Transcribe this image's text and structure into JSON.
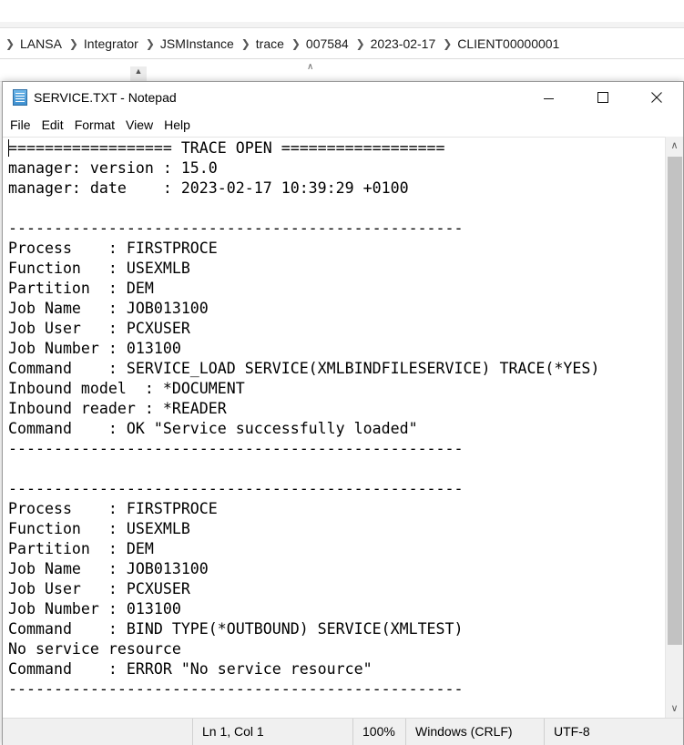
{
  "explorer": {
    "breadcrumb": [
      "LANSA",
      "Integrator",
      "JSMInstance",
      "trace",
      "007584",
      "2023-02-17",
      "CLIENT00000001"
    ]
  },
  "window": {
    "title": "SERVICE.TXT - Notepad",
    "menu": [
      "File",
      "Edit",
      "Format",
      "View",
      "Help"
    ]
  },
  "document": {
    "lines": [
      "================== TRACE OPEN ==================",
      "manager: version : 15.0",
      "manager: date    : 2023-02-17 10:39:29 +0100",
      "",
      "--------------------------------------------------",
      "Process    : FIRSTPROCE",
      "Function   : USEXMLB",
      "Partition  : DEM",
      "Job Name   : JOB013100",
      "Job User   : PCXUSER",
      "Job Number : 013100",
      "Command    : SERVICE_LOAD SERVICE(XMLBINDFILESERVICE) TRACE(*YES)",
      "Inbound model  : *DOCUMENT",
      "Inbound reader : *READER",
      "Command    : OK \"Service successfully loaded\"",
      "--------------------------------------------------",
      "",
      "--------------------------------------------------",
      "Process    : FIRSTPROCE",
      "Function   : USEXMLB",
      "Partition  : DEM",
      "Job Name   : JOB013100",
      "Job User   : PCXUSER",
      "Job Number : 013100",
      "Command    : BIND TYPE(*OUTBOUND) SERVICE(XMLTEST)",
      "No service resource",
      "Command    : ERROR \"No service resource\"",
      "--------------------------------------------------"
    ]
  },
  "status": {
    "position": "Ln 1, Col 1",
    "zoom": "100%",
    "line_ending": "Windows (CRLF)",
    "encoding": "UTF-8"
  },
  "icons": {
    "breadcrumb_separator": "chevron-right-icon",
    "app": "notepad-icon",
    "minimize": "minimize-icon",
    "maximize": "maximize-icon",
    "close": "close-icon",
    "scroll_up": "scroll-up-icon",
    "scroll_down": "scroll-down-icon"
  }
}
